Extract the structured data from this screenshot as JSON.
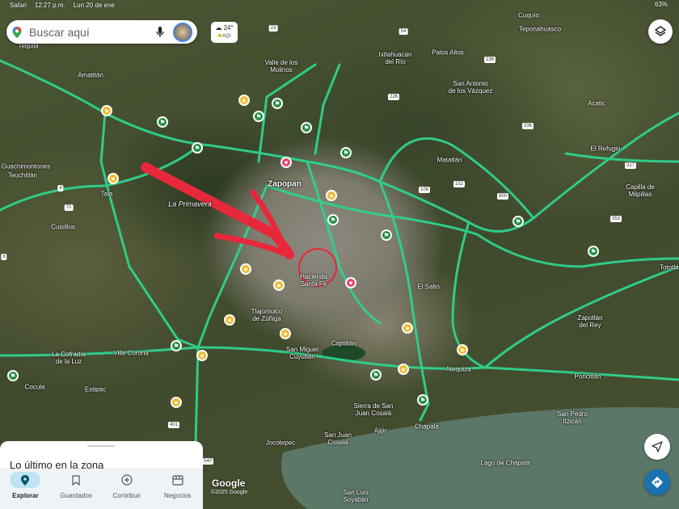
{
  "status_bar": {
    "app": "Safari",
    "time": "12:27 p.m.",
    "date": "Lun 20 de ene",
    "battery": "63%"
  },
  "search": {
    "placeholder": "Buscar aquí"
  },
  "weather": {
    "temp": "24°",
    "aqi": "AQI"
  },
  "map": {
    "labels": [
      "Tequila",
      "Amatitán",
      "Guachimontones",
      "Teuchitlán",
      "Tala",
      "Cuisillos",
      "La Primavera",
      "Valle de los\nMolinos",
      "Zapopan",
      "Ixtlahuacán\ndel Río",
      "Palos Altos",
      "Cuquío",
      "Teponahuasco",
      "San Antonio\nde los Vázquez",
      "Acatic",
      "El Refugio",
      "Matatlán",
      "Capilla de\nMilpillas",
      "Tototlán",
      "Hacienda\nSanta Fe",
      "El Salto",
      "Tlajomulco\nde Zúñiga",
      "Zapotlán\ndel Rey",
      "Cajititlán",
      "San Miguel\nCuyutlán",
      "La Cofradía\nde la Luz",
      "Villa Corona",
      "Atequiza",
      "Poncitlán",
      "Estipac",
      "Cocula",
      "Sierra de San\nJuan Cosalá",
      "Chapala",
      "San Pedro\nItzicán",
      "Jocotepec",
      "San Juan\nCosalá",
      "Ajijic",
      "Lago de Chapala",
      "San Luis\nSoyatlán"
    ],
    "shields": [
      "23",
      "54",
      "226",
      "236",
      "336",
      "106",
      "152",
      "800",
      "317",
      "353",
      "70",
      "4",
      "401",
      "540",
      "8"
    ],
    "attribution": {
      "logo": "Google",
      "copyright": "©2025 Google"
    }
  },
  "sheet": {
    "title": "Lo último en la zona"
  },
  "nav": [
    {
      "label": "Explorar",
      "icon": "explore-pin-icon"
    },
    {
      "label": "Guardados",
      "icon": "bookmark-icon"
    },
    {
      "label": "Contribuir",
      "icon": "add-circle-icon"
    },
    {
      "label": "Negocios",
      "icon": "storefront-icon"
    }
  ],
  "colors": {
    "road": "#2fd28e",
    "annotation": "#e8283a",
    "lake": "#5b7768"
  }
}
